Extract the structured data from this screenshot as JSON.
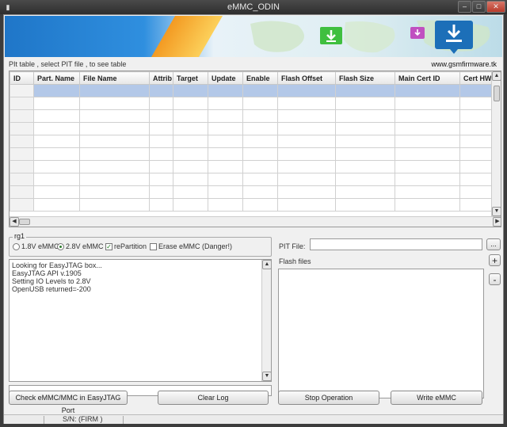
{
  "window": {
    "title": "eMMC_ODIN"
  },
  "banner": {
    "site": "www.gsmfirmware.tk"
  },
  "pit_table": {
    "caption": "PIt table , select PIT file , to see table",
    "columns": [
      "ID",
      "Part. Name",
      "File Name",
      "Attrib",
      "Target",
      "Update",
      "Enable",
      "Flash Offset",
      "Flash Size",
      "Main Cert ID",
      "Cert HW"
    ],
    "row_count": 10
  },
  "voltage_group": {
    "title": "rg1",
    "option_18": "1.8V eMMC",
    "option_28": "2.8V eMMC",
    "selected": "2.8V eMMC",
    "repartition_label": "rePartition",
    "repartition_checked": true,
    "erase_label": "Erase eMMC (Danger!)",
    "erase_checked": false
  },
  "log": {
    "lines": [
      "Looking for EasyJTAG box...",
      "EasyJTAG API v.1905",
      "Setting IO Levels to 2.8V",
      "OpenUSB returned=-200"
    ]
  },
  "pit_file": {
    "label": "PIT File:",
    "value": "",
    "browse_label": "..."
  },
  "flash_files": {
    "label": "Flash files",
    "add_label": "+",
    "remove_label": "-"
  },
  "buttons": {
    "check": "Check eMMC/MMC in EasyJTAG Port",
    "clear_log": "Clear Log",
    "stop": "Stop Operation",
    "write": "Write eMMC"
  },
  "statusbar": {
    "sn": "S/N:  (FIRM )"
  },
  "colors": {
    "selection": "#b3c8e8",
    "titlebar": "#3c3c3c",
    "banner_orange": "#f39a22",
    "banner_blue": "#1f76c8"
  }
}
